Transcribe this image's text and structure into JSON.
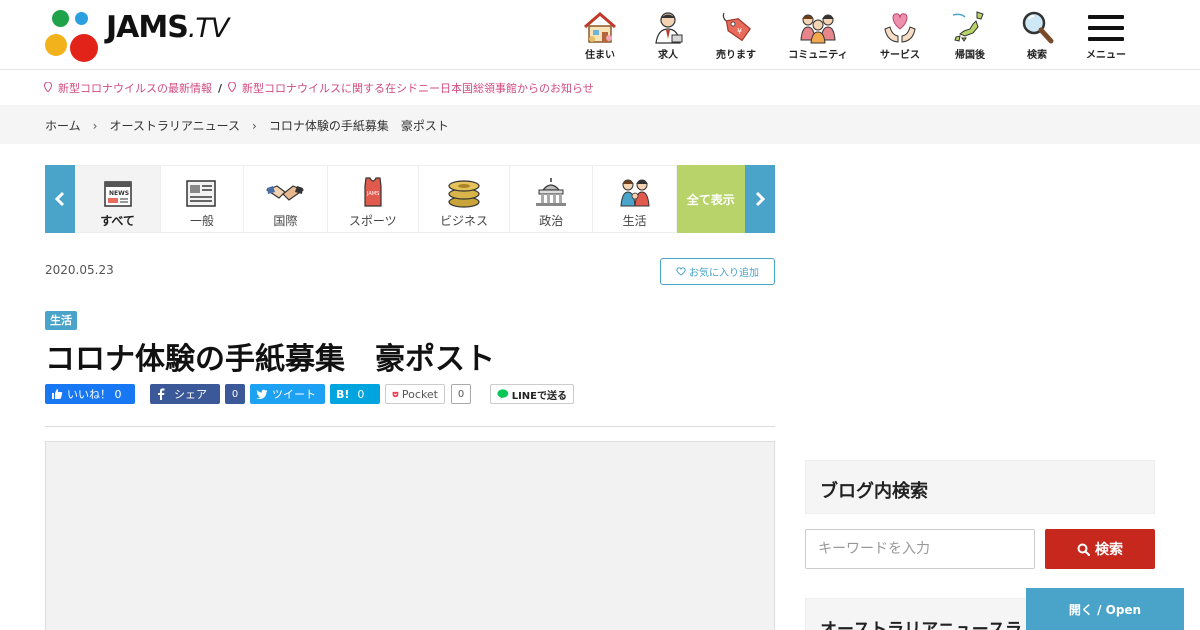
{
  "header": {
    "logo_text": "JAMS",
    "logo_tv": ".TV",
    "nav": [
      {
        "label": "住まい",
        "icon": "house-icon"
      },
      {
        "label": "求人",
        "icon": "job-person-icon"
      },
      {
        "label": "売ります",
        "icon": "price-tag-icon"
      },
      {
        "label": "コミュニティ",
        "icon": "community-people-icon"
      },
      {
        "label": "サービス",
        "icon": "heart-hands-icon"
      },
      {
        "label": "帰国後",
        "icon": "japan-map-icon"
      },
      {
        "label": "検索",
        "icon": "magnifier-icon"
      },
      {
        "label": "メニュー",
        "icon": "hamburger-menu-icon"
      }
    ]
  },
  "notice": {
    "items": [
      "新型コロナウイルスの最新情報",
      "新型コロナウイルスに関する在シドニー日本国総領事館からのお知らせ"
    ],
    "separator": "/"
  },
  "breadcrumb": [
    "ホーム",
    "オーストラリアニュース",
    "コロナ体験の手紙募集　豪ポスト"
  ],
  "categories": [
    {
      "label": "すべて",
      "icon": "news-icon"
    },
    {
      "label": "一般",
      "icon": "newspaper-icon"
    },
    {
      "label": "国際",
      "icon": "handshake-icon"
    },
    {
      "label": "スポーツ",
      "icon": "jersey-icon"
    },
    {
      "label": "ビジネス",
      "icon": "coins-icon"
    },
    {
      "label": "政治",
      "icon": "capitol-icon"
    },
    {
      "label": "生活",
      "icon": "family-icon"
    }
  ],
  "all_label": "全て表示",
  "article": {
    "date": "2020.05.23",
    "favorite_label": "お気に入り追加",
    "category_tag": "生活",
    "title": "コロナ体験の手紙募集　豪ポスト"
  },
  "share": {
    "like_label": "いいね！ 0",
    "fb_share_label": "シェア",
    "fb_count": "0",
    "tweet_label": "ツイート",
    "hatena_label": "B!",
    "hatena_count": "0",
    "pocket_label": "Pocket",
    "pocket_count": "0",
    "line_label": "LINEで送る"
  },
  "sidebar": {
    "blog_search_title": "ブログ内検索",
    "search_placeholder": "キーワードを入力",
    "search_button": "検索",
    "news_title": "オーストラリアニュースラ"
  },
  "open_tab": "開く / Open",
  "colors": {
    "accent_blue": "#4aa3c9",
    "accent_green": "#b8d36a",
    "search_red": "#c7281e",
    "notice_pink": "#d04c82",
    "facebook": "#3b5998",
    "twitter": "#1da1f2",
    "hatena": "#00a4de"
  }
}
